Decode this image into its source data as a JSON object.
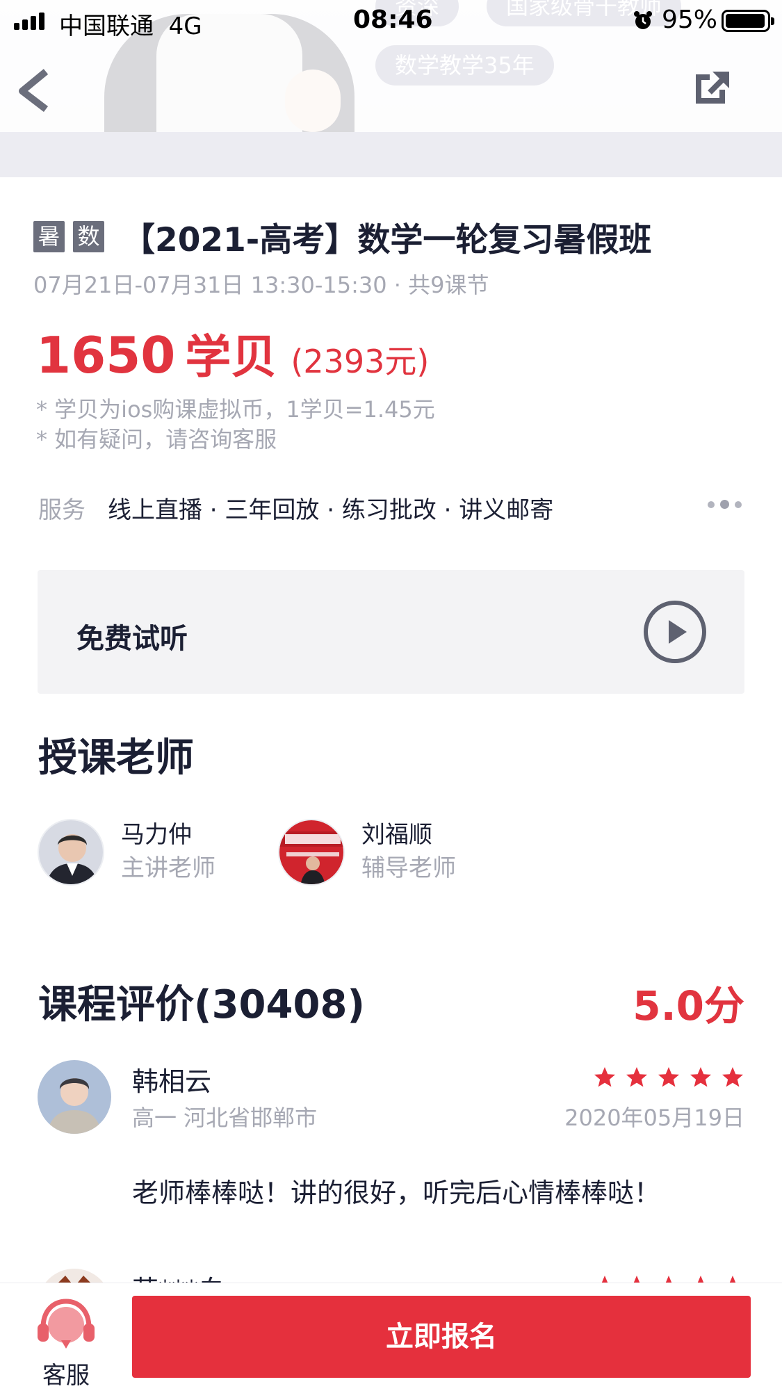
{
  "status_bar": {
    "carrier": "中国联通",
    "network": "4G",
    "time": "08:46",
    "battery": "95%"
  },
  "hero": {
    "chips": [
      "资深",
      "国家级骨干教师",
      "数学教学35年"
    ]
  },
  "course": {
    "tags": [
      "暑",
      "数"
    ],
    "title": "【2021-高考】数学一轮复习暑假班",
    "schedule": "07月21日-07月31日 13:30-15:30 · 共9课节",
    "price": {
      "amount": "1650",
      "unit": "学贝",
      "rmb": "(2393元)"
    },
    "notes": [
      "* 学贝为ios购课虚拟币，1学贝=1.45元",
      "* 如有疑问，请咨询客服"
    ],
    "service": {
      "label": "服务",
      "value": "线上直播 · 三年回放 · 练习批改 · 讲义邮寄"
    },
    "trial_label": "免费试听"
  },
  "teachers": {
    "title": "授课老师",
    "items": [
      {
        "name": "马力仲",
        "role": "主讲老师"
      },
      {
        "name": "刘福顺",
        "role": "辅导老师"
      }
    ]
  },
  "reviews": {
    "title": "课程评价(30408)",
    "score": "5.0分",
    "items": [
      {
        "name": "韩相云",
        "meta": "高一  河北省邯郸市",
        "date": "2020年05月19日",
        "stars": 5,
        "body": "老师棒棒哒！讲的很好，听完后心情棒棒哒！"
      },
      {
        "name": "苏***白",
        "stars": 5
      }
    ]
  },
  "bottom_bar": {
    "service_label": "客服",
    "enroll_label": "立即报名"
  },
  "colors": {
    "accent": "#e5303d",
    "text_primary": "#1b1f33",
    "text_secondary": "#a6a8b3",
    "tag_bg": "#6b6e7c",
    "card_bg": "#f3f3f5"
  }
}
